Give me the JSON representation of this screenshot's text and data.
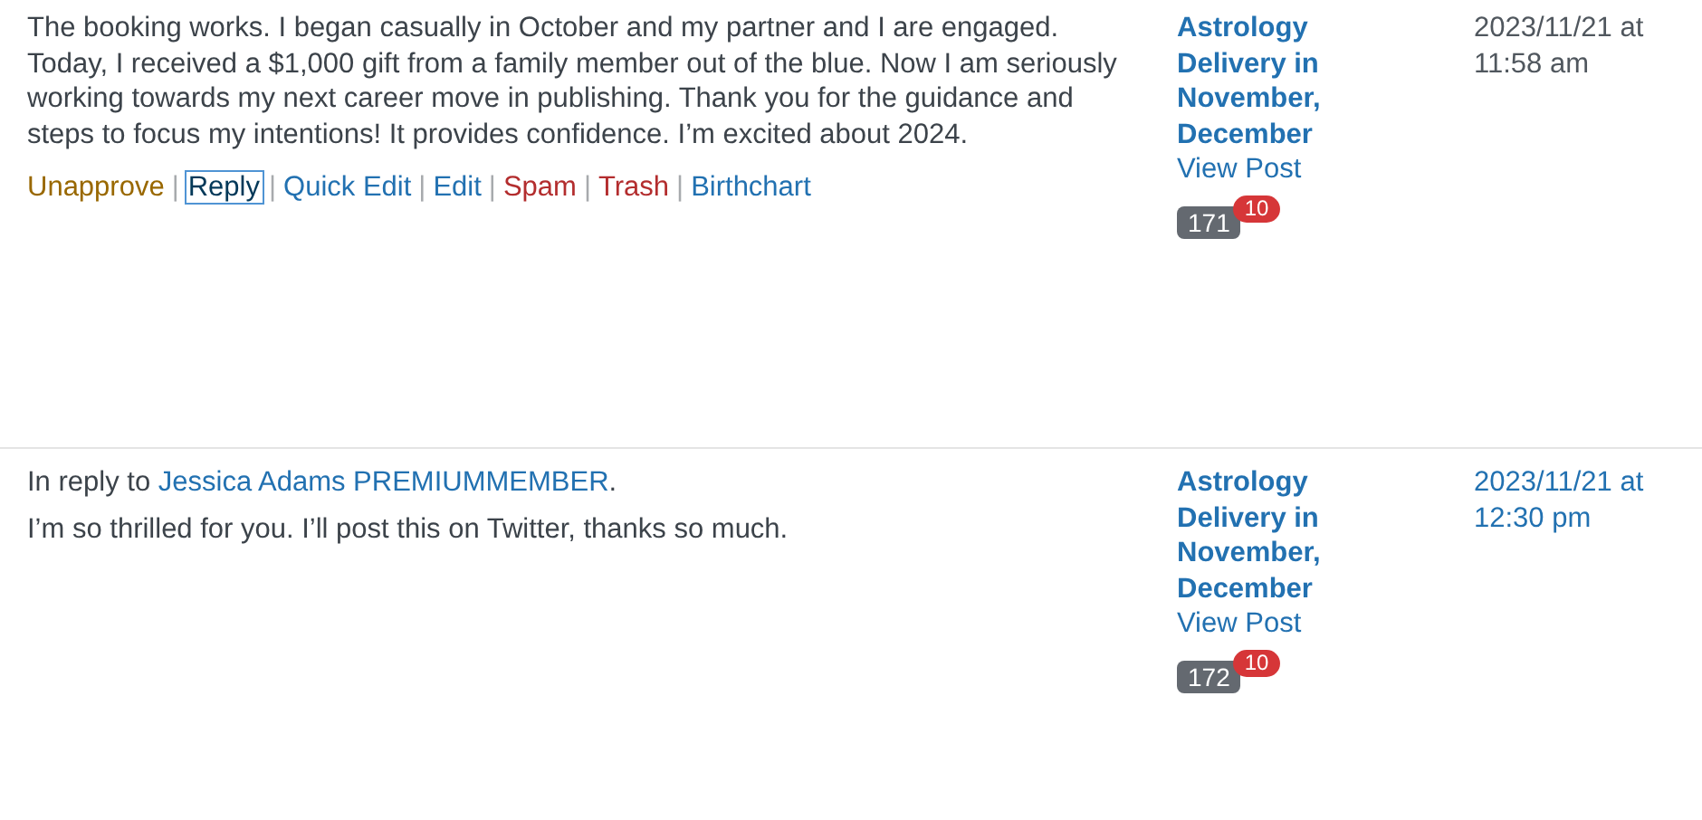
{
  "comments": [
    {
      "text": "The booking works. I began casually in October and my partner and I are engaged. Today, I received a $1,000 gift from a family member out of the blue. Now I am seriously working towards my next career move in publishing. Thank you for the guidance and steps to focus my intentions! It provides confidence. I’m excited about 2024.",
      "actions": [
        {
          "label": "Unapprove",
          "kind": "unapprove",
          "focused": false
        },
        {
          "separator": "|",
          "label": "Reply",
          "kind": "normal",
          "focused": true
        },
        {
          "separator": "|",
          "label": "Quick Edit",
          "kind": "normal",
          "focused": false
        },
        {
          "separator": "|",
          "label": "Edit",
          "kind": "normal",
          "focused": false
        },
        {
          "separator": "|",
          "label": "Spam",
          "kind": "delete",
          "focused": false
        },
        {
          "separator": "|",
          "label": "Trash",
          "kind": "delete",
          "focused": false
        },
        {
          "separator": "|",
          "label": "Birthchart",
          "kind": "normal",
          "focused": false
        }
      ],
      "post_title": "Astrology Delivery in November, December",
      "view_post": "View Post",
      "approved_count": "171",
      "pending_count": "10",
      "date_line1": "2023/11/21 at",
      "date_line2": "11:58 am",
      "date_linked": false
    },
    {
      "in_reply_to": {
        "prefix": "In reply to",
        "author": "Jessica Adams PREMIUMMEMBER",
        "suffix": "."
      },
      "text": "I’m so thrilled for you. I’ll post this on Twitter, thanks so much.",
      "post_title": "Astrology Delivery in November, December",
      "view_post": "View Post",
      "approved_count": "172",
      "pending_count": "10",
      "date_line1": "2023/11/21 at",
      "date_line2": "12:30 pm",
      "date_linked": true
    }
  ]
}
